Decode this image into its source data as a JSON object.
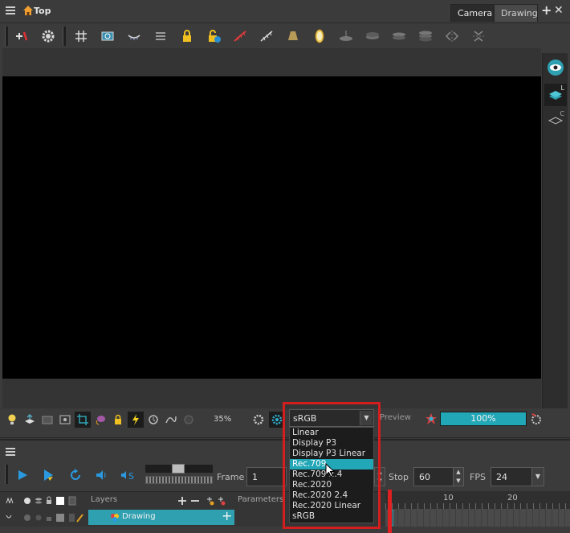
{
  "view": {
    "title": "Top",
    "tabs": [
      "Camera",
      "Drawing"
    ],
    "zoom": "35%",
    "colorspace_selected": "sRGB",
    "preview_label": "Preview",
    "preview_progress_label": "100%",
    "preview_progress": 1.0
  },
  "dropdown": {
    "options": [
      "Linear",
      "Display P3",
      "Display P3 Linear",
      "Rec.709",
      "Rec.709 2.4",
      "Rec.2020",
      "Rec.2020 2.4",
      "Rec.2020 Linear",
      "sRGB"
    ],
    "highlighted": "Rec.709",
    "highlight_color": "#22a7b7",
    "frame_color": "#d21e1e"
  },
  "timeline": {
    "frame_label": "Frame",
    "frame_value": "1",
    "stop_label": "Stop",
    "stop_value": "60",
    "fps_label": "FPS",
    "fps_value": "24",
    "layers_label": "Layers",
    "parameters_label": "Parameters",
    "ruler_numbers": [
      "10",
      "20"
    ],
    "layer_name": "Drawing",
    "layer_color": "#2fa0b0"
  },
  "right_strip": {
    "labels": [
      "L",
      "C"
    ]
  }
}
